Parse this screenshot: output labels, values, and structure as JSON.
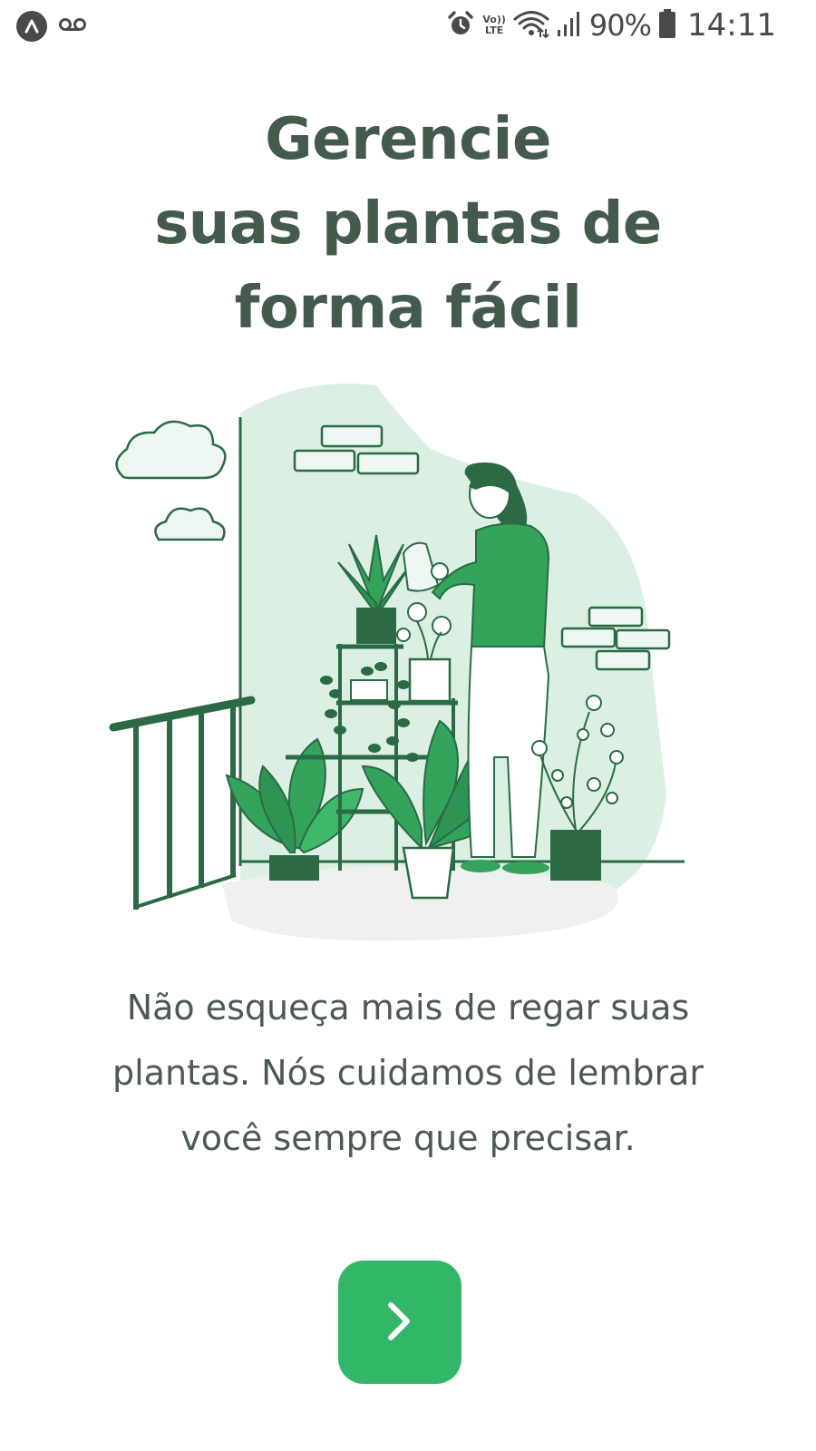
{
  "status_bar": {
    "app_icon": "launcher-a-icon",
    "voicemail_icon": "voicemail-icon",
    "alarm_icon": "alarm-clock-icon",
    "volte_line1": "Vo))",
    "volte_line2": "LTE",
    "wifi_icon": "wifi-icon",
    "signal_icon": "signal-bars-icon",
    "battery_percent": "90%",
    "battery_icon": "battery-icon",
    "time": "14:11"
  },
  "onboarding": {
    "title_lines": [
      "Gerencie",
      "suas plantas de",
      "forma fácil"
    ],
    "illustration_icon": "woman-watering-plants-illustration",
    "description": "Não esqueça mais de regar suas plantas. Nós cuidamos de lembrar você sempre que precisar.",
    "next_icon": "chevron-right-icon"
  },
  "colors": {
    "title": "#445a4d",
    "text": "#4a5a51",
    "accent": "#32b768",
    "illustration_bg": "#dbf0e2",
    "illustration_dark": "#2b6a44",
    "illustration_mid": "#34a35b"
  }
}
